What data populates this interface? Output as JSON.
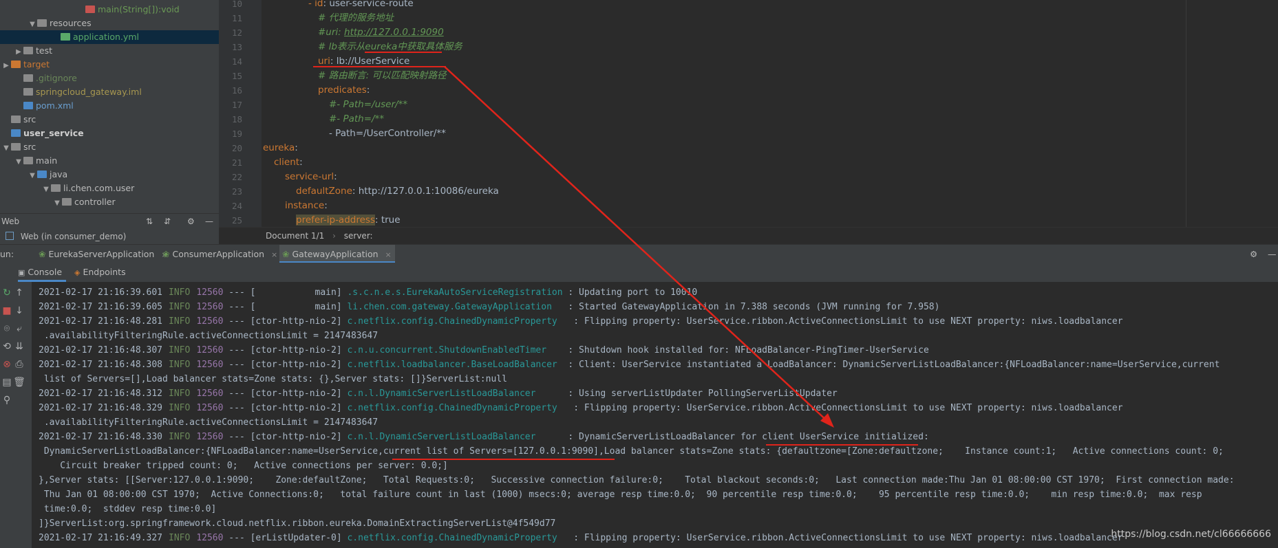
{
  "project_tree": [
    {
      "label": "main(String[]):void",
      "indent": 110,
      "arrow": "",
      "icon": "method",
      "selected": false
    },
    {
      "label": "resources",
      "indent": 40,
      "arrow": "▼",
      "icon": "folder",
      "selected": false
    },
    {
      "label": "application.yml",
      "indent": 74,
      "arrow": "",
      "icon": "yml",
      "selected": true
    },
    {
      "label": "test",
      "indent": 20,
      "arrow": "▶",
      "icon": "folder",
      "selected": false
    },
    {
      "label": "target",
      "indent": 2,
      "arrow": "▶",
      "icon": "folder-orange",
      "selected": false
    },
    {
      "label": ".gitignore",
      "indent": 20,
      "arrow": "",
      "icon": "file",
      "selected": false
    },
    {
      "label": "springcloud_gateway.iml",
      "indent": 20,
      "arrow": "",
      "icon": "file",
      "selected": false
    },
    {
      "label": "pom.xml",
      "indent": 20,
      "arrow": "",
      "icon": "maven",
      "selected": false
    },
    {
      "label": "src",
      "indent": 2,
      "arrow": "",
      "icon": "folder",
      "selected": false
    },
    {
      "label": "user_service",
      "indent": 2,
      "arrow": "",
      "icon": "module",
      "selected": false
    },
    {
      "label": "src",
      "indent": 2,
      "arrow": "▼",
      "icon": "folder",
      "selected": false
    },
    {
      "label": "main",
      "indent": 20,
      "arrow": "▼",
      "icon": "folder",
      "selected": false
    },
    {
      "label": "java",
      "indent": 40,
      "arrow": "▼",
      "icon": "folder-blue",
      "selected": false
    },
    {
      "label": "li.chen.com.user",
      "indent": 60,
      "arrow": "▼",
      "icon": "package",
      "selected": false
    },
    {
      "label": "controller",
      "indent": 76,
      "arrow": "▼",
      "icon": "package",
      "selected": false
    }
  ],
  "tree_panel": {
    "title": "Web",
    "row": "Web (in consumer_demo)"
  },
  "line_numbers": [
    "10",
    "11",
    "12",
    "13",
    "14",
    "15",
    "16",
    "17",
    "18",
    "19",
    "20",
    "21",
    "22",
    "23",
    "24",
    "25"
  ],
  "code": {
    "l10": {
      "key": "- id",
      "val": ": user-service-route"
    },
    "l11": "# 代理的服务地址",
    "l12": {
      "pre": "#uri: ",
      "url": "http://127.0.0.1:9090"
    },
    "l13": "# lb表示从eureka中获取具体服务",
    "l14": {
      "key": "uri",
      "val": ": lb://UserService"
    },
    "l15": "# 路由断言: 可以匹配映射路径",
    "l16": {
      "key": "predicates",
      "val": ":"
    },
    "l17": "#- Path=/user/**",
    "l18": "#- Path=/**",
    "l19": "- Path=/UserController/**",
    "l20": {
      "key": "eureka",
      "val": ":"
    },
    "l21": {
      "key": "client",
      "val": ":"
    },
    "l22": {
      "key": "service-url",
      "val": ":"
    },
    "l23": {
      "key": "defaultZone",
      "val": ": http://127.0.0.1:10086/eureka"
    },
    "l24": {
      "key": "instance",
      "val": ":"
    },
    "l25": {
      "key": "prefer-ip-address",
      "val": ": true"
    }
  },
  "breadcrumb": {
    "doc": "Document 1/1",
    "sep": "›",
    "path": "server:"
  },
  "run": {
    "label": "un:",
    "tabs": [
      {
        "label": "EurekaServerApplication",
        "active": false
      },
      {
        "label": "ConsumerApplication",
        "active": false
      },
      {
        "label": "GatewayApplication",
        "active": true
      }
    ],
    "close": "×",
    "subtabs": [
      {
        "label": "Console",
        "active": true
      },
      {
        "label": "Endpoints",
        "active": false
      }
    ]
  },
  "console": [
    {
      "ts": "2021-02-17 21:16:39.601",
      "lvl": "INFO",
      "pid": "12560",
      "mid": " --- [           main] ",
      "logger": ".s.c.n.e.s.EurekaAutoServiceRegistration",
      "msg": " : Updating port to 10010"
    },
    {
      "ts": "2021-02-17 21:16:39.605",
      "lvl": "INFO",
      "pid": "12560",
      "mid": " --- [           main] ",
      "logger": "li.chen.com.gateway.GatewayApplication  ",
      "msg": " : Started GatewayApplication in 7.388 seconds (JVM running for 7.958)"
    },
    {
      "ts": "2021-02-17 21:16:48.281",
      "lvl": "INFO",
      "pid": "12560",
      "mid": " --- [ctor-http-nio-2] ",
      "logger": "c.netflix.config.ChainedDynamicProperty  ",
      "msg": " : Flipping property: UserService.ribbon.ActiveConnectionsLimit to use NEXT property: niws.loadbalancer"
    },
    {
      "raw": " .availabilityFilteringRule.activeConnectionsLimit = 2147483647"
    },
    {
      "ts": "2021-02-17 21:16:48.307",
      "lvl": "INFO",
      "pid": "12560",
      "mid": " --- [ctor-http-nio-2] ",
      "logger": "c.n.u.concurrent.ShutdownEnabledTimer   ",
      "msg": " : Shutdown hook installed for: NFLoadBalancer-PingTimer-UserService"
    },
    {
      "ts": "2021-02-17 21:16:48.308",
      "lvl": "INFO",
      "pid": "12560",
      "mid": " --- [ctor-http-nio-2] ",
      "logger": "c.netflix.loadbalancer.BaseLoadBalancer ",
      "msg": " : Client: UserService instantiated a LoadBalancer: DynamicServerListLoadBalancer:{NFLoadBalancer:name=UserService,current"
    },
    {
      "raw": " list of Servers=[],Load balancer stats=Zone stats: {},Server stats: []}ServerList:null"
    },
    {
      "ts": "2021-02-17 21:16:48.312",
      "lvl": "INFO",
      "pid": "12560",
      "mid": " --- [ctor-http-nio-2] ",
      "logger": "c.n.l.DynamicServerListLoadBalancer     ",
      "msg": " : Using serverListUpdater PollingServerListUpdater"
    },
    {
      "ts": "2021-02-17 21:16:48.329",
      "lvl": "INFO",
      "pid": "12560",
      "mid": " --- [ctor-http-nio-2] ",
      "logger": "c.netflix.config.ChainedDynamicProperty  ",
      "msg": " : Flipping property: UserService.ribbon.ActiveConnectionsLimit to use NEXT property: niws.loadbalancer"
    },
    {
      "raw": " .availabilityFilteringRule.activeConnectionsLimit = 2147483647"
    },
    {
      "ts": "2021-02-17 21:16:48.330",
      "lvl": "INFO",
      "pid": "12560",
      "mid": " --- [ctor-http-nio-2] ",
      "logger": "c.n.l.DynamicServerListLoadBalancer     ",
      "msg": " : DynamicServerListLoadBalancer for client UserService initialized:"
    },
    {
      "raw": " DynamicServerListLoadBalancer:{NFLoadBalancer:name=UserService,current list of Servers=[127.0.0.1:9090],Load balancer stats=Zone stats: {defaultzone=[Zone:defaultzone;    Instance count:1;   Active connections count: 0;"
    },
    {
      "raw": "    Circuit breaker tripped count: 0;   Active connections per server: 0.0;]"
    },
    {
      "raw": "},Server stats: [[Server:127.0.0.1:9090;    Zone:defaultZone;   Total Requests:0;   Successive connection failure:0;    Total blackout seconds:0;   Last connection made:Thu Jan 01 08:00:00 CST 1970;  First connection made:"
    },
    {
      "raw": " Thu Jan 01 08:00:00 CST 1970;  Active Connections:0;   total failure count in last (1000) msecs:0; average resp time:0.0;  90 percentile resp time:0.0;    95 percentile resp time:0.0;    min resp time:0.0;  max resp"
    },
    {
      "raw": " time:0.0;  stddev resp time:0.0]"
    },
    {
      "raw": "]}ServerList:org.springframework.cloud.netflix.ribbon.eureka.DomainExtractingServerList@4f549d77"
    },
    {
      "ts": "2021-02-17 21:16:49.327",
      "lvl": "INFO",
      "pid": "12560",
      "mid": " --- [erListUpdater-0] ",
      "logger": "c.netflix.config.ChainedDynamicProperty  ",
      "msg": " : Flipping property: UserService.ribbon.ActiveConnectionsLimit to use NEXT property: niws.loadbalancer"
    }
  ],
  "watermark": "https://blog.csdn.net/cl66666666",
  "colors": {
    "annotation": "#e0241b",
    "accent": "#4a88c7"
  }
}
